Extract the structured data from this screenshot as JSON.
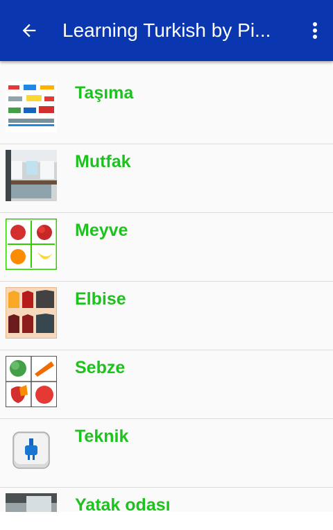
{
  "app_bar": {
    "title": "Learning Turkish by Pi...",
    "back_icon": "arrow-left-icon",
    "menu_icon": "more-vertical-icon"
  },
  "colors": {
    "app_bar": "#0a37b0",
    "label": "#1ec21e",
    "divider": "#dcdcdc"
  },
  "categories": [
    {
      "label": "Taşıma",
      "icon": "transport-thumbnail"
    },
    {
      "label": "Mutfak",
      "icon": "kitchen-thumbnail"
    },
    {
      "label": "Meyve",
      "icon": "fruit-thumbnail"
    },
    {
      "label": "Elbise",
      "icon": "clothes-thumbnail"
    },
    {
      "label": "Sebze",
      "icon": "vegetable-thumbnail"
    },
    {
      "label": "Teknik",
      "icon": "plug-thumbnail"
    },
    {
      "label": "Yatak odası",
      "icon": "bedroom-thumbnail"
    }
  ]
}
